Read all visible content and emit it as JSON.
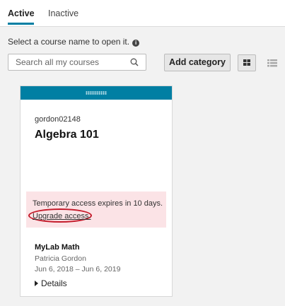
{
  "tabs": [
    {
      "label": "Active",
      "active": true
    },
    {
      "label": "Inactive",
      "active": false
    }
  ],
  "instruction": "Select a course name to open it.",
  "search": {
    "placeholder": "Search all my courses",
    "value": ""
  },
  "toolbar": {
    "add_category_label": "Add category",
    "grid_view_icon": "grid-view-icon",
    "list_view_icon": "list-view-icon"
  },
  "colors": {
    "accent": "#007fa3",
    "warning_bg": "#fbe3e6",
    "annotation": "#c41a2a",
    "page_bg": "#f2f2f2"
  },
  "course": {
    "code": "gordon02148",
    "title": "Algebra 101",
    "warning_text": "Temporary access expires in 10 days.",
    "upgrade_link": "Upgrade access.",
    "product": "MyLab Math",
    "instructor": "Patricia Gordon",
    "dates": "Jun 6, 2018 – Jun 6, 2019",
    "details_label": "Details"
  }
}
